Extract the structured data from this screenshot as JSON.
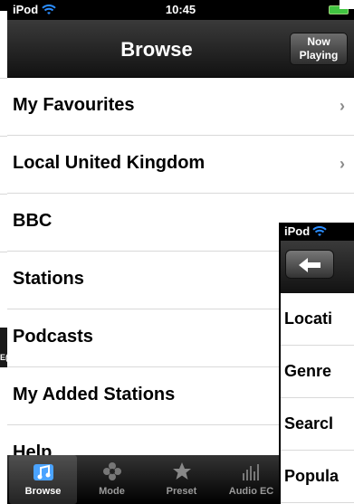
{
  "main": {
    "status": {
      "carrier": "iPod",
      "time": "10:45"
    },
    "nav": {
      "title": "Browse",
      "now_playing": "Now Playing",
      "now_playing_line1": "Now",
      "now_playing_line2": "Playing"
    },
    "items": [
      {
        "label": "My Favourites",
        "chevron": "›"
      },
      {
        "label": "Local United Kingdom",
        "chevron": "›"
      },
      {
        "label": "BBC",
        "chevron": ""
      },
      {
        "label": "Stations",
        "chevron": ""
      },
      {
        "label": "Podcasts",
        "chevron": ""
      },
      {
        "label": "My Added Stations",
        "chevron": ""
      },
      {
        "label": "Help",
        "chevron": ""
      }
    ],
    "tabs": [
      {
        "label": "Browse",
        "icon": "music-note-icon",
        "active": true
      },
      {
        "label": "Mode",
        "icon": "flower-icon",
        "active": false
      },
      {
        "label": "Preset",
        "icon": "star-icon",
        "active": false
      },
      {
        "label": "Audio EC",
        "icon": "equalizer-icon",
        "active": false
      }
    ]
  },
  "second_screen": {
    "status": {
      "carrier": "iPod"
    },
    "items": [
      "Locati",
      "Genre",
      "Searcl",
      "Popula"
    ]
  },
  "background_left": {
    "fragment": "E("
  },
  "colors": {
    "battery": "#41c441",
    "accent_blue": "#2a8cff"
  }
}
